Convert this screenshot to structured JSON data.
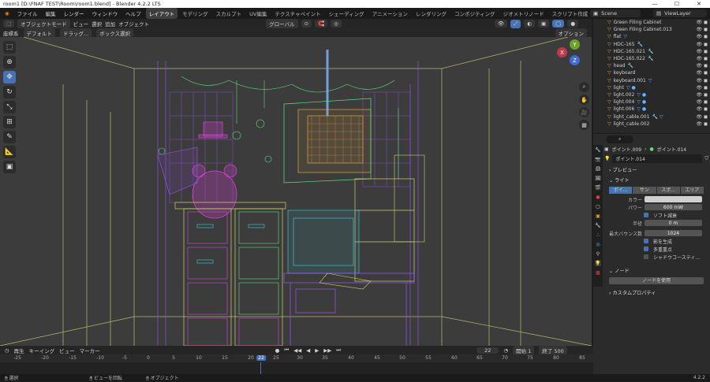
{
  "window": {
    "title": "room1 [D:\\FNAF TEST\\Room\\room1.blend] - Blender 4.2.2 LTS",
    "minimize": "—",
    "maximize": "☐",
    "close": "✕"
  },
  "menu": [
    "ファイル",
    "編集",
    "レンダー",
    "ウィンドウ",
    "ヘルプ"
  ],
  "workspaces": [
    "レイアウト",
    "モデリング",
    "スカルプト",
    "UV編集",
    "テクスチャペイント",
    "シェーディング",
    "アニメーション",
    "レンダリング",
    "コンポジティング",
    "ジオメトリノード",
    "スクリプト作成"
  ],
  "scene": {
    "scene_name": "Scene",
    "view_layer": "ViewLayer"
  },
  "viewport_header": {
    "mode": "オブジェクトモード",
    "view": "ビュー",
    "select": "選択",
    "add": "追加",
    "object": "オブジェクト",
    "orientation": "グローバル",
    "options": "オプション"
  },
  "viewport_header2": {
    "coord_label": "座標系",
    "coord_value": "デフォルト",
    "drag_label": "ドラッグ...",
    "select_box": "ボックス選択"
  },
  "outliner": {
    "items": [
      {
        "name": "Green Filing Cabinet"
      },
      {
        "name": "Green Filing Cabinet.013"
      },
      {
        "name": "flat"
      },
      {
        "name": "HDC-165"
      },
      {
        "name": "HDC-165.021"
      },
      {
        "name": "HDC-165.022"
      },
      {
        "name": "head"
      },
      {
        "name": "keyboard"
      },
      {
        "name": "keyboard.001"
      },
      {
        "name": "light"
      },
      {
        "name": "light.002"
      },
      {
        "name": "light.004"
      },
      {
        "name": "light.006"
      },
      {
        "name": "light_cable.001"
      },
      {
        "name": "light_cable.002"
      }
    ]
  },
  "properties": {
    "breadcrumb_obj": "ポイント.009",
    "breadcrumb_data": "ポイント.014",
    "datablock": "ポイント.014",
    "preview": "プレビュー",
    "light_section": "ライト",
    "light_types": [
      "ポイ...",
      "サン",
      "スポ...",
      "エリア"
    ],
    "color_label": "カラー",
    "power_label": "パワー",
    "power_value": "600 mW",
    "soft_falloff": "ソフト減衰",
    "radius_label": "半径",
    "radius_value": "0 m",
    "max_bounces_label": "最大バウンス数",
    "max_bounces_value": "1024",
    "cast_shadow": "影を生成",
    "multiple_importance": "多重重点",
    "shadow_caustics": "シャドウコースティ...",
    "nodes_section": "ノード",
    "use_nodes_button": "ノードを使用",
    "custom_props": "カスタムプロパティ"
  },
  "timeline": {
    "playback": "再生",
    "keying": "キーイング",
    "view": "ビュー",
    "marker": "マーカー",
    "current_frame": "22",
    "start_label": "開始",
    "start_value": "1",
    "end_label": "終了",
    "end_value": "500",
    "ruler": [
      "-25",
      "-20",
      "-15",
      "-10",
      "-5",
      "0",
      "5",
      "10",
      "15",
      "20",
      "22",
      "25",
      "30",
      "35",
      "40",
      "45",
      "50",
      "55",
      "60",
      "65",
      "70",
      "75",
      "80",
      "85"
    ]
  },
  "status": {
    "select": "選択",
    "rotate_view": "ビューを回転",
    "object": "オブジェクト",
    "version": "4.2.2"
  },
  "colors": {
    "accent": "#4772b3",
    "wire_orange": "#e8a23a",
    "wire_yellow": "#e8e060",
    "wire_pink": "#e040e0",
    "wire_cyan": "#40d0e0",
    "wire_green": "#60e080",
    "wire_purple": "#a050ff"
  }
}
